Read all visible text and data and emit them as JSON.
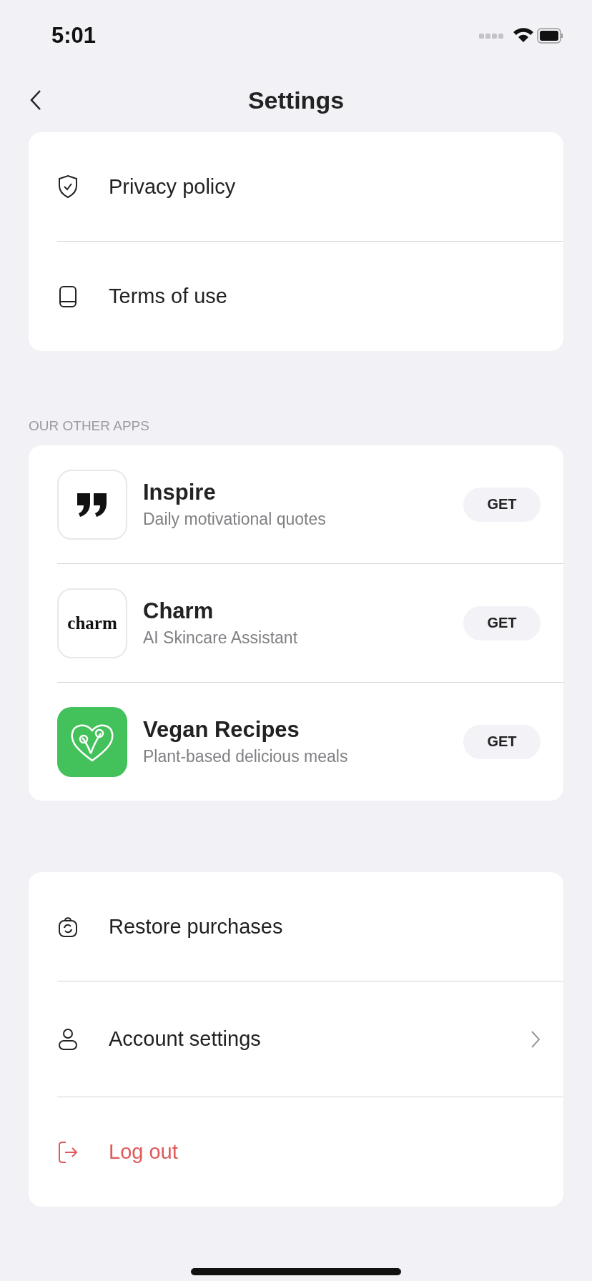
{
  "status_bar": {
    "time": "5:01"
  },
  "nav": {
    "title": "Settings"
  },
  "legal": [
    {
      "label": "Privacy policy"
    },
    {
      "label": "Terms of use"
    }
  ],
  "other_apps": {
    "header": "OUR OTHER APPS",
    "apps": [
      {
        "name": "Inspire",
        "subtitle": "Daily motivational quotes",
        "button": "GET"
      },
      {
        "name": "Charm",
        "subtitle": "AI Skincare Assistant",
        "button": "GET",
        "logo_text": "charm"
      },
      {
        "name": "Vegan Recipes",
        "subtitle": "Plant-based delicious meals",
        "button": "GET"
      }
    ]
  },
  "account": [
    {
      "label": "Restore purchases",
      "kind": "plain"
    },
    {
      "label": "Account settings",
      "kind": "navigation"
    },
    {
      "label": "Log out",
      "kind": "destructive"
    }
  ]
}
